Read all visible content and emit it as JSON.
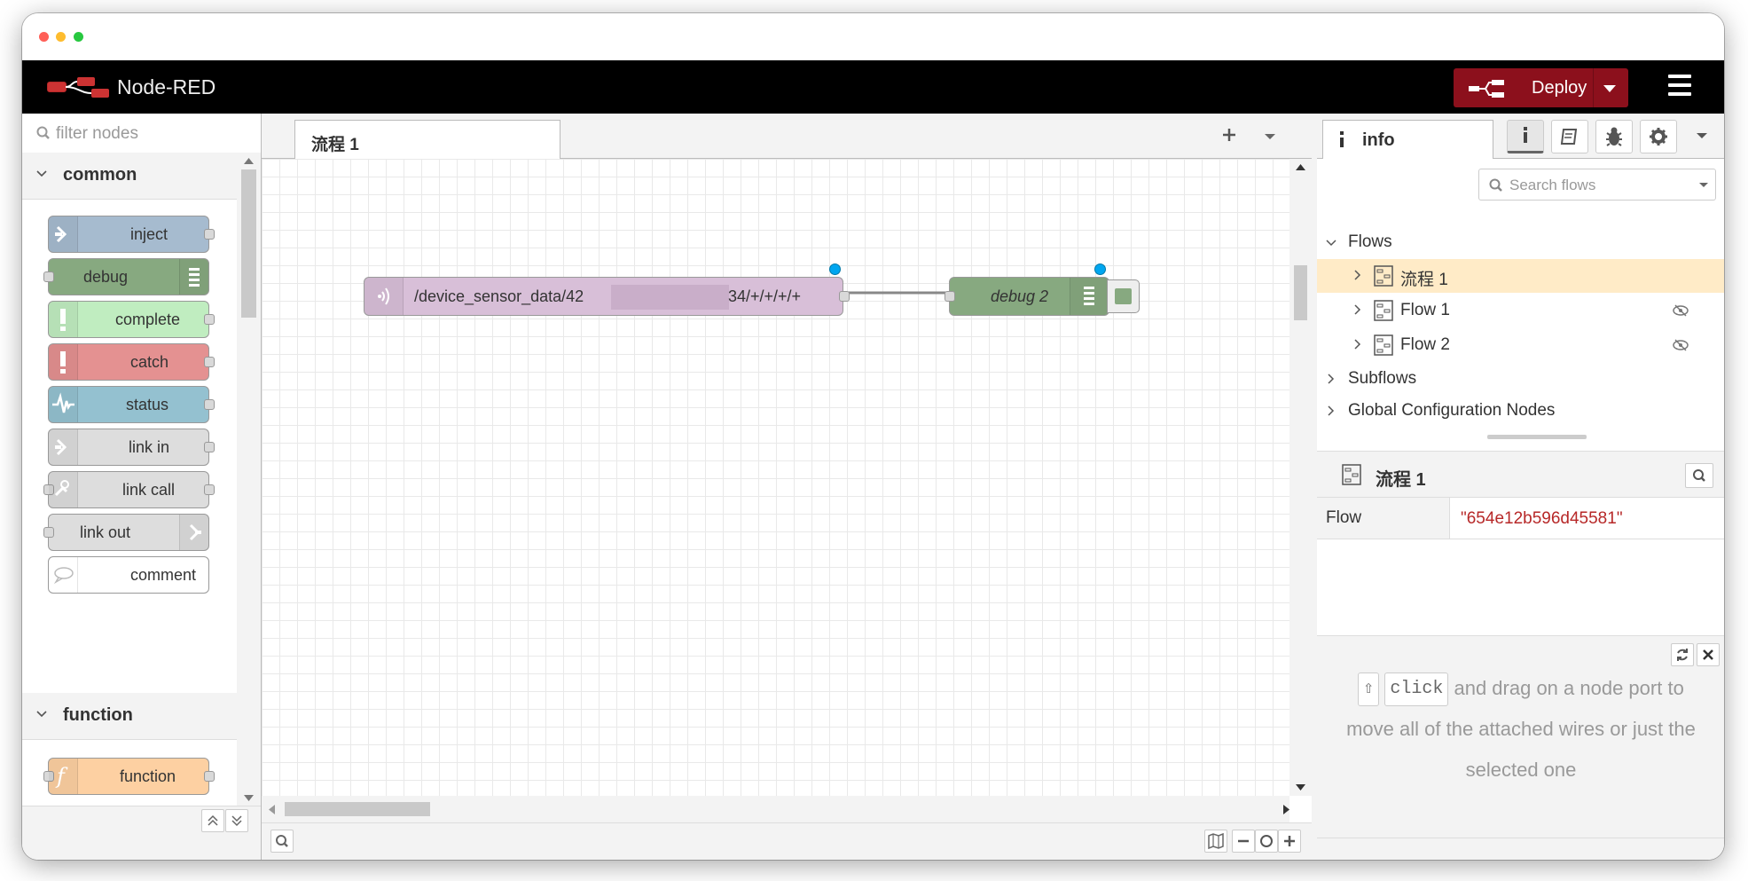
{
  "app": {
    "title": "Node-RED"
  },
  "header": {
    "deploy_label": "Deploy"
  },
  "palette": {
    "filter_placeholder": "filter nodes",
    "categories": [
      {
        "label": "common"
      },
      {
        "label": "function"
      }
    ],
    "nodes": [
      {
        "label": "inject",
        "color": "#a6bbcf"
      },
      {
        "label": "debug",
        "color": "#87a980"
      },
      {
        "label": "complete",
        "color": "#c0edc0"
      },
      {
        "label": "catch",
        "color": "#e49191"
      },
      {
        "label": "status",
        "color": "#94c1d0"
      },
      {
        "label": "link in",
        "color": "#dddddd"
      },
      {
        "label": "link call",
        "color": "#dddddd"
      },
      {
        "label": "link out",
        "color": "#dddddd"
      },
      {
        "label": "comment",
        "color": "#ffffff"
      },
      {
        "label": "function",
        "color": "#fdd0a2"
      }
    ]
  },
  "workspace": {
    "tab_label": "流程 1",
    "flow_nodes": {
      "mqtt_in": {
        "label": "/device_sensor_data/42",
        "label_suffix": "34/+/+/+/+",
        "color": "#d8bfd8"
      },
      "debug2": {
        "label": "debug 2",
        "color": "#87a980"
      }
    }
  },
  "sidebar": {
    "tab_label": "info",
    "search_placeholder": "Search flows",
    "tree": {
      "flows_label": "Flows",
      "items": [
        {
          "label": "流程 1"
        },
        {
          "label": "Flow 1"
        },
        {
          "label": "Flow 2"
        }
      ],
      "subflows_label": "Subflows",
      "global_config_label": "Global Configuration Nodes"
    },
    "info": {
      "title": "流程 1",
      "prop_key": "Flow",
      "prop_value": "\"654e12b596d45581\""
    },
    "tips": {
      "kbd_label": "click",
      "text_line1": "and drag on a node port",
      "text_rest": "to move all of the attached wires or just the selected one"
    }
  }
}
